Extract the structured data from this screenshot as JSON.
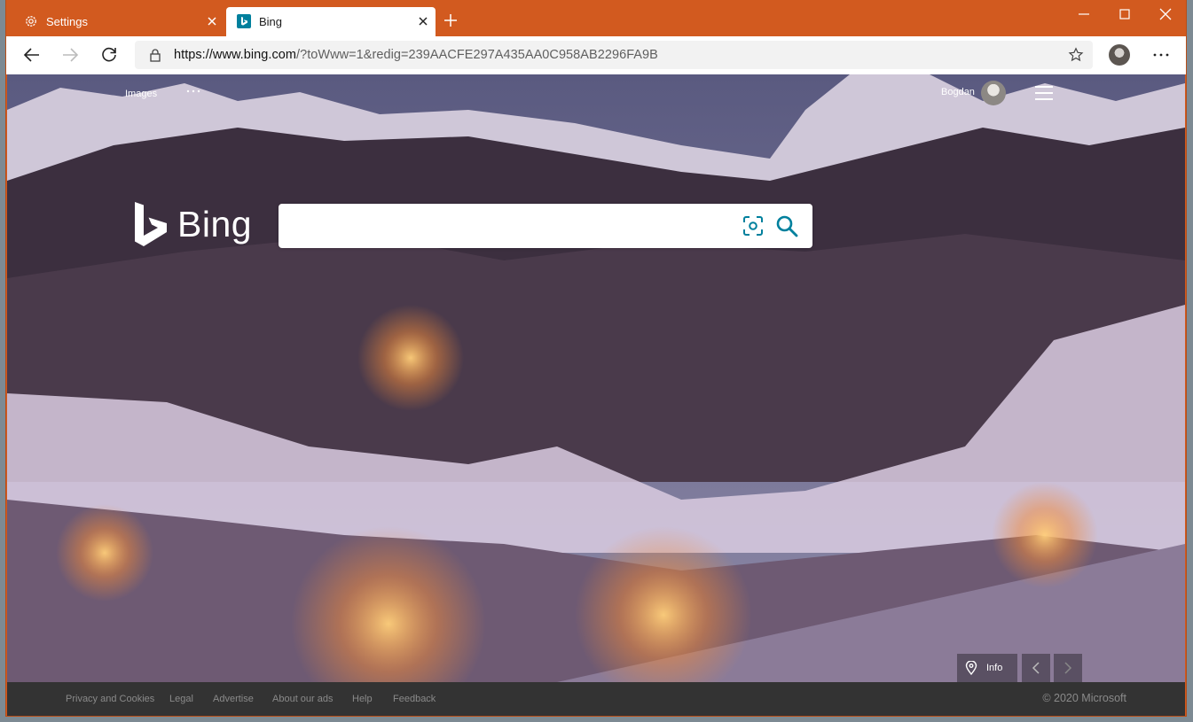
{
  "tabs": [
    {
      "title": "Settings",
      "icon": "gear-icon"
    },
    {
      "title": "Bing",
      "icon": "bing-icon"
    }
  ],
  "address_bar": {
    "url_host": "https://www.bing.com",
    "url_rest": "/?toWww=1&redig=239AACFE297A435AA0C958AB2296FA9B"
  },
  "bing": {
    "logo_text": "Bing",
    "nav_images": "Images",
    "user_name": "Bogdan",
    "search_value": "",
    "info_label": "Info"
  },
  "footer": {
    "links": [
      "Privacy and Cookies",
      "Legal",
      "Advertise",
      "About our ads",
      "Help",
      "Feedback"
    ],
    "copyright": "© 2020 Microsoft"
  },
  "colors": {
    "titlebar": "#d25a1f",
    "bing_teal": "#00809d",
    "footer_bg": "#333333"
  }
}
